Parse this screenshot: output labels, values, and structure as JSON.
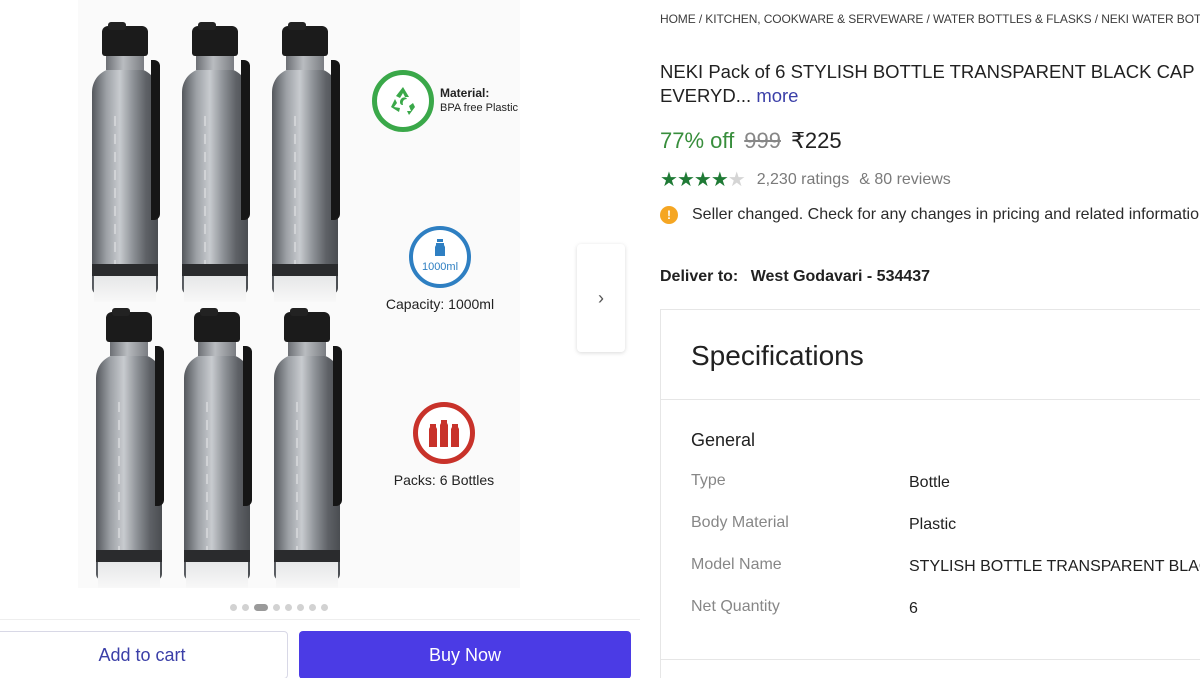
{
  "gallery": {
    "features": [
      {
        "icon": "recycle-icon",
        "label": "Material:",
        "sublabel": "BPA free Plastic"
      },
      {
        "icon": "bottle-icon",
        "badge": "1000ml",
        "label": "Capacity: 1000ml"
      },
      {
        "icon": "bottles-icon",
        "label": "Packs: 6 Bottles"
      }
    ],
    "dots_total": 8,
    "dots_active": 3,
    "next_icon": "chevron-right-icon"
  },
  "actions": {
    "add_to_cart": "Add to cart",
    "buy_now": "Buy Now",
    "buy_color": "#4b3be5"
  },
  "product": {
    "breadcrumb": "HOME / KITCHEN, COOKWARE & SERVEWARE / WATER BOTTLES & FLASKS / NEKI WATER BOTTLES",
    "title_line1": "NEKI Pack of 6 STYLISH BOTTLE TRANSPARENT BLACK CAP",
    "title_line2": "EVERYD...",
    "more": "more",
    "discount": "77% off",
    "mrp": "999",
    "price": "₹225",
    "rating_stars": 4,
    "ratings": "2,230 ratings",
    "reviews": "& 80 reviews",
    "notice": "Seller changed. Check for any changes in pricing and related information",
    "deliver_label": "Deliver to:",
    "deliver_location": "West Godavari - 534437",
    "discount_color": "#388e3c"
  },
  "specifications": {
    "title": "Specifications",
    "group": "General",
    "rows": [
      {
        "key": "Type",
        "value": "Bottle"
      },
      {
        "key": "Body Material",
        "value": "Plastic"
      },
      {
        "key": "Model Name",
        "value": "STYLISH BOTTLE TRANSPARENT BLACK CAP"
      },
      {
        "key": "Net Quantity",
        "value": "6"
      }
    ]
  }
}
